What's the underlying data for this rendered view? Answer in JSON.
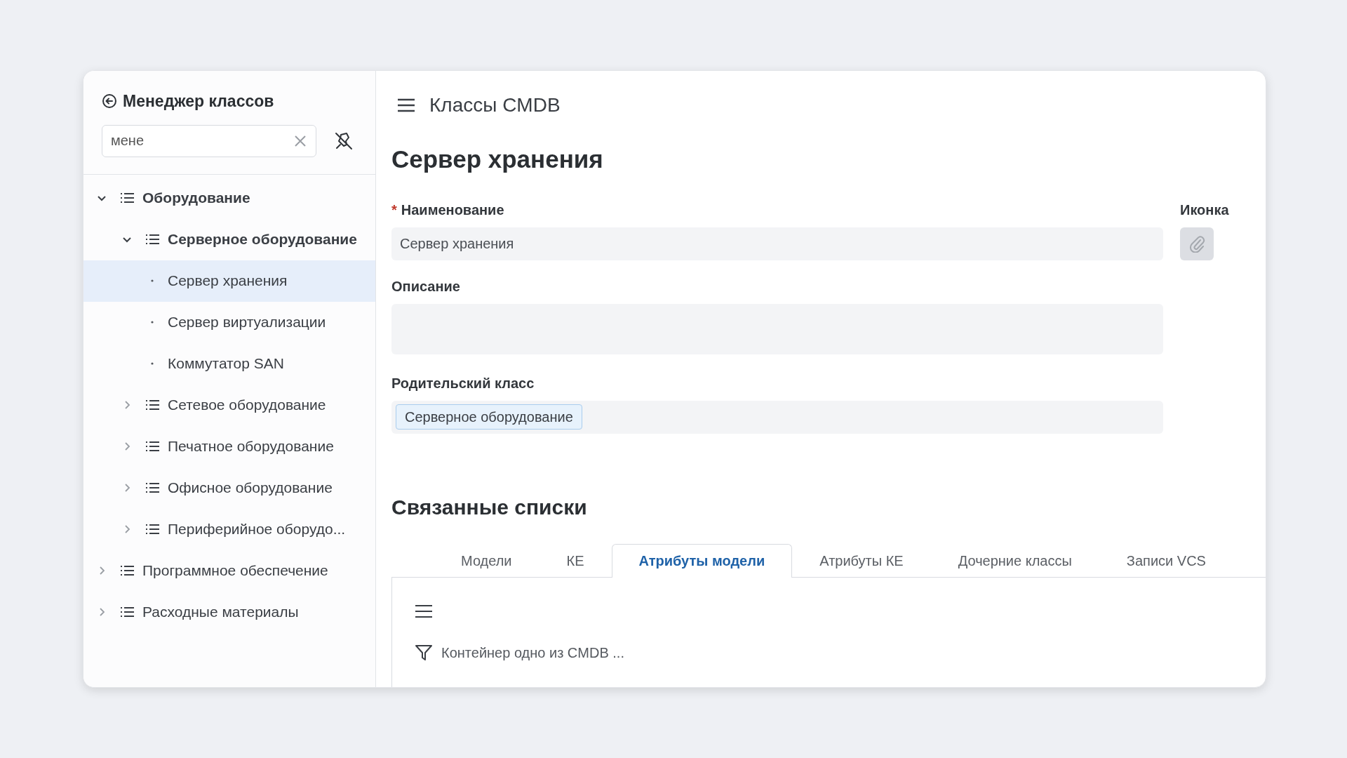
{
  "sidebar": {
    "title": "Менеджер классов",
    "search": {
      "value": "мене"
    },
    "tree": [
      {
        "label": "Оборудование",
        "kind": "group",
        "expanded": true,
        "selected": false,
        "children": [
          {
            "label": "Серверное оборудование",
            "kind": "group",
            "expanded": true,
            "selected": false,
            "children": [
              {
                "label": "Сервер хранения",
                "kind": "leaf",
                "selected": true
              },
              {
                "label": "Сервер виртуализации",
                "kind": "leaf",
                "selected": false
              },
              {
                "label": "Коммутатор SAN",
                "kind": "leaf",
                "selected": false
              }
            ]
          },
          {
            "label": "Сетевое оборудование",
            "kind": "group",
            "expanded": false,
            "selected": false
          },
          {
            "label": "Печатное оборудование",
            "kind": "group",
            "expanded": false,
            "selected": false
          },
          {
            "label": "Офисное оборудование",
            "kind": "group",
            "expanded": false,
            "selected": false
          },
          {
            "label": "Периферийное оборудо...",
            "kind": "group",
            "expanded": false,
            "selected": false
          }
        ]
      },
      {
        "label": "Программное обеспечение",
        "kind": "group",
        "expanded": false,
        "selected": false
      },
      {
        "label": "Расходные материалы",
        "kind": "group",
        "expanded": false,
        "selected": false
      }
    ]
  },
  "header": {
    "title": "Классы CMDB"
  },
  "form": {
    "title": "Сервер хранения",
    "fields": [
      {
        "label": "Наименование",
        "required_mark": "*",
        "kind": "text",
        "value": "Сервер хранения"
      },
      {
        "label": "Описание",
        "kind": "textarea"
      },
      {
        "label": "Родительский класс",
        "kind": "reference",
        "chips": [
          "Серверное оборудование"
        ]
      }
    ],
    "icon_field": {
      "label": "Иконка"
    }
  },
  "related": {
    "title": "Связанные списки",
    "tabs": [
      {
        "label": "Модели",
        "selected": false
      },
      {
        "label": "КЕ",
        "selected": false
      },
      {
        "label": "Атрибуты модели",
        "selected": true
      },
      {
        "label": "Атрибуты КЕ",
        "selected": false
      },
      {
        "label": "Дочерние классы",
        "selected": false
      },
      {
        "label": "Записи VCS",
        "selected": false
      }
    ],
    "filter": "Контейнер одно из CMDB ..."
  }
}
